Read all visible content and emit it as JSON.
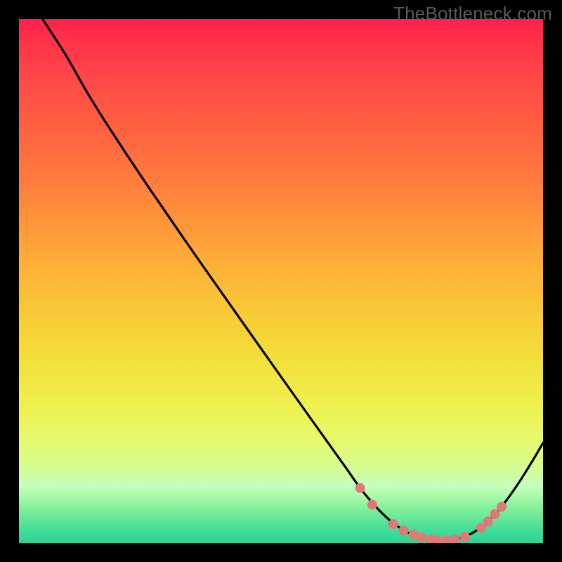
{
  "watermark_text": "TheBottleneck.com",
  "chart_data": {
    "type": "line",
    "title": "",
    "xlabel": "",
    "ylabel": "",
    "xlim": [
      0,
      100
    ],
    "ylim": [
      0,
      100
    ],
    "grid": false,
    "legend": null,
    "note": "No axis ticks or labels are shown; values are normalized 0–100 estimates read from pixel positions.",
    "series": [
      {
        "name": "curve",
        "style": "line",
        "color": "#000000",
        "points": [
          {
            "x": 4.5,
            "y": 100.0
          },
          {
            "x": 9.0,
            "y": 93.0
          },
          {
            "x": 13.0,
            "y": 86.0
          },
          {
            "x": 17.5,
            "y": 78.8
          },
          {
            "x": 25.0,
            "y": 67.5
          },
          {
            "x": 35.0,
            "y": 53.0
          },
          {
            "x": 45.0,
            "y": 38.8
          },
          {
            "x": 55.0,
            "y": 24.7
          },
          {
            "x": 62.0,
            "y": 14.9
          },
          {
            "x": 65.8,
            "y": 9.6
          },
          {
            "x": 70.0,
            "y": 5.0
          },
          {
            "x": 73.5,
            "y": 2.4
          },
          {
            "x": 77.0,
            "y": 1.0
          },
          {
            "x": 80.6,
            "y": 0.5
          },
          {
            "x": 84.0,
            "y": 0.9
          },
          {
            "x": 87.0,
            "y": 2.2
          },
          {
            "x": 90.0,
            "y": 4.6
          },
          {
            "x": 92.6,
            "y": 7.6
          },
          {
            "x": 95.5,
            "y": 11.7
          },
          {
            "x": 98.0,
            "y": 15.7
          },
          {
            "x": 100.0,
            "y": 19.1
          }
        ]
      },
      {
        "name": "markers",
        "style": "scatter",
        "color": "#e27874",
        "points": [
          {
            "x": 65.1,
            "y": 10.5
          },
          {
            "x": 67.4,
            "y": 7.3
          },
          {
            "x": 71.4,
            "y": 3.6
          },
          {
            "x": 73.4,
            "y": 2.4
          },
          {
            "x": 75.3,
            "y": 1.6
          },
          {
            "x": 76.8,
            "y": 1.1
          },
          {
            "x": 78.6,
            "y": 0.7
          },
          {
            "x": 79.9,
            "y": 0.5
          },
          {
            "x": 81.6,
            "y": 0.5
          },
          {
            "x": 83.2,
            "y": 0.7
          },
          {
            "x": 85.1,
            "y": 1.2
          },
          {
            "x": 88.2,
            "y": 2.9
          },
          {
            "x": 89.5,
            "y": 4.1
          },
          {
            "x": 90.8,
            "y": 5.5
          },
          {
            "x": 92.1,
            "y": 6.9
          }
        ]
      }
    ]
  }
}
